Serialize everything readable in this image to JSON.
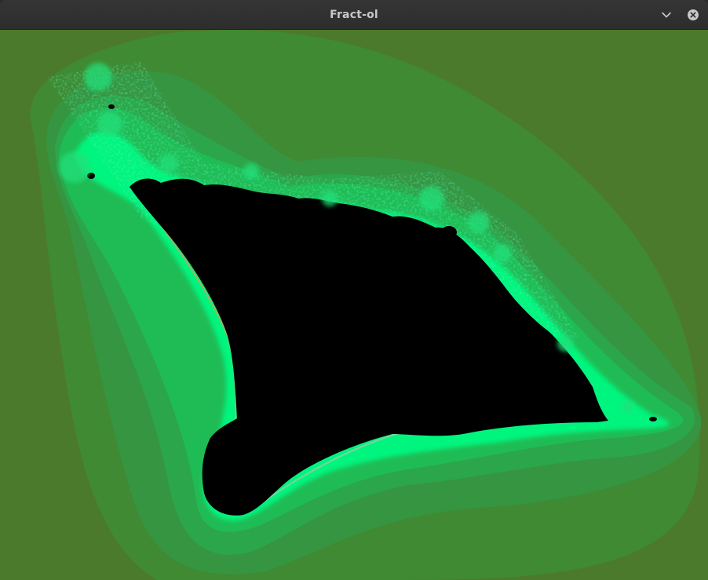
{
  "window": {
    "title": "Fract-ol"
  },
  "titlebar": {
    "buttons": [
      {
        "name": "minimize",
        "icon": "chevron-down-icon"
      },
      {
        "name": "close",
        "icon": "close-circle-icon"
      }
    ]
  },
  "canvas": {
    "content": "fractal-render",
    "colors": {
      "background": "#4c7a2c",
      "outer_bands": [
        "#3f8a33",
        "#359a3c",
        "#2aa846",
        "#1fba50"
      ],
      "edge_glow": "#00ff88",
      "edge_accent": "#c7a45a",
      "interior": "#000000"
    }
  }
}
